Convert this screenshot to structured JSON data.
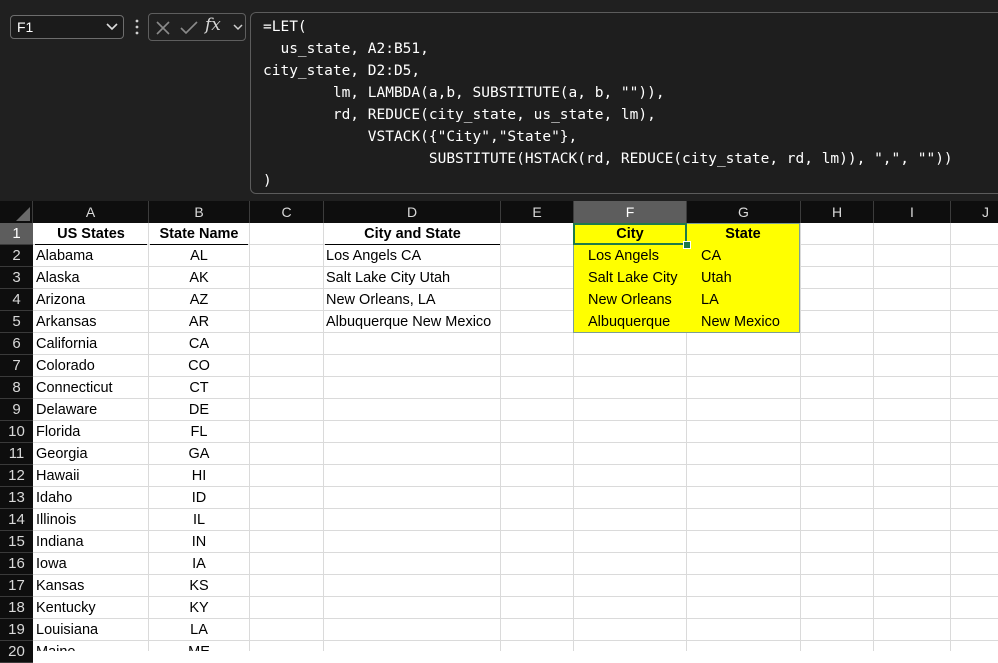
{
  "formula_bar": {
    "name_box": "F1",
    "fx_label": "fx",
    "formula_lines": [
      "=LET(",
      "  us_state, A2:B51,",
      "city_state, D2:D5,",
      "        lm, LAMBDA(a,b, SUBSTITUTE(a, b, \"\")),",
      "        rd, REDUCE(city_state, us_state, lm),",
      "            VSTACK({\"City\",\"State\"},",
      "                   SUBSTITUTE(HSTACK(rd, REDUCE(city_state, rd, lm)), \",\", \"\"))",
      ")"
    ]
  },
  "sheet": {
    "selected_column": "F",
    "columns": [
      "A",
      "B",
      "C",
      "D",
      "E",
      "F",
      "G",
      "H",
      "I",
      "J"
    ],
    "rows": [
      "1",
      "2",
      "3",
      "4",
      "5",
      "6",
      "7",
      "8",
      "9",
      "10",
      "11",
      "12",
      "13",
      "14",
      "15",
      "16",
      "17",
      "18",
      "19",
      "20"
    ],
    "headers": {
      "A": "US States",
      "B": "State Name",
      "D": "City and State",
      "F": "City",
      "G": "State"
    },
    "states": [
      {
        "name": "Alabama",
        "abbr": "AL"
      },
      {
        "name": "Alaska",
        "abbr": "AK"
      },
      {
        "name": "Arizona",
        "abbr": "AZ"
      },
      {
        "name": "Arkansas",
        "abbr": "AR"
      },
      {
        "name": "California",
        "abbr": "CA"
      },
      {
        "name": "Colorado",
        "abbr": "CO"
      },
      {
        "name": "Connecticut",
        "abbr": "CT"
      },
      {
        "name": "Delaware",
        "abbr": "DE"
      },
      {
        "name": "Florida",
        "abbr": "FL"
      },
      {
        "name": "Georgia",
        "abbr": "GA"
      },
      {
        "name": "Hawaii",
        "abbr": "HI"
      },
      {
        "name": "Idaho",
        "abbr": "ID"
      },
      {
        "name": "Illinois",
        "abbr": "IL"
      },
      {
        "name": "Indiana",
        "abbr": "IN"
      },
      {
        "name": "Iowa",
        "abbr": "IA"
      },
      {
        "name": "Kansas",
        "abbr": "KS"
      },
      {
        "name": "Kentucky",
        "abbr": "KY"
      },
      {
        "name": "Louisiana",
        "abbr": "LA"
      },
      {
        "name": "Maine",
        "abbr": "ME"
      }
    ],
    "city_and_state": [
      "Los Angels CA",
      "Salt Lake City Utah",
      "New Orleans, LA",
      "Albuquerque New Mexico"
    ],
    "results": [
      {
        "city": "Los Angels",
        "state": "CA"
      },
      {
        "city": "Salt Lake City",
        "state": "Utah"
      },
      {
        "city": "New Orleans",
        "state": "LA"
      },
      {
        "city": "Albuquerque",
        "state": "New Mexico"
      }
    ]
  },
  "colors": {
    "highlight": "#ffff00",
    "selection": "#1f7a4a",
    "header_bg": "#0e0e0e"
  }
}
